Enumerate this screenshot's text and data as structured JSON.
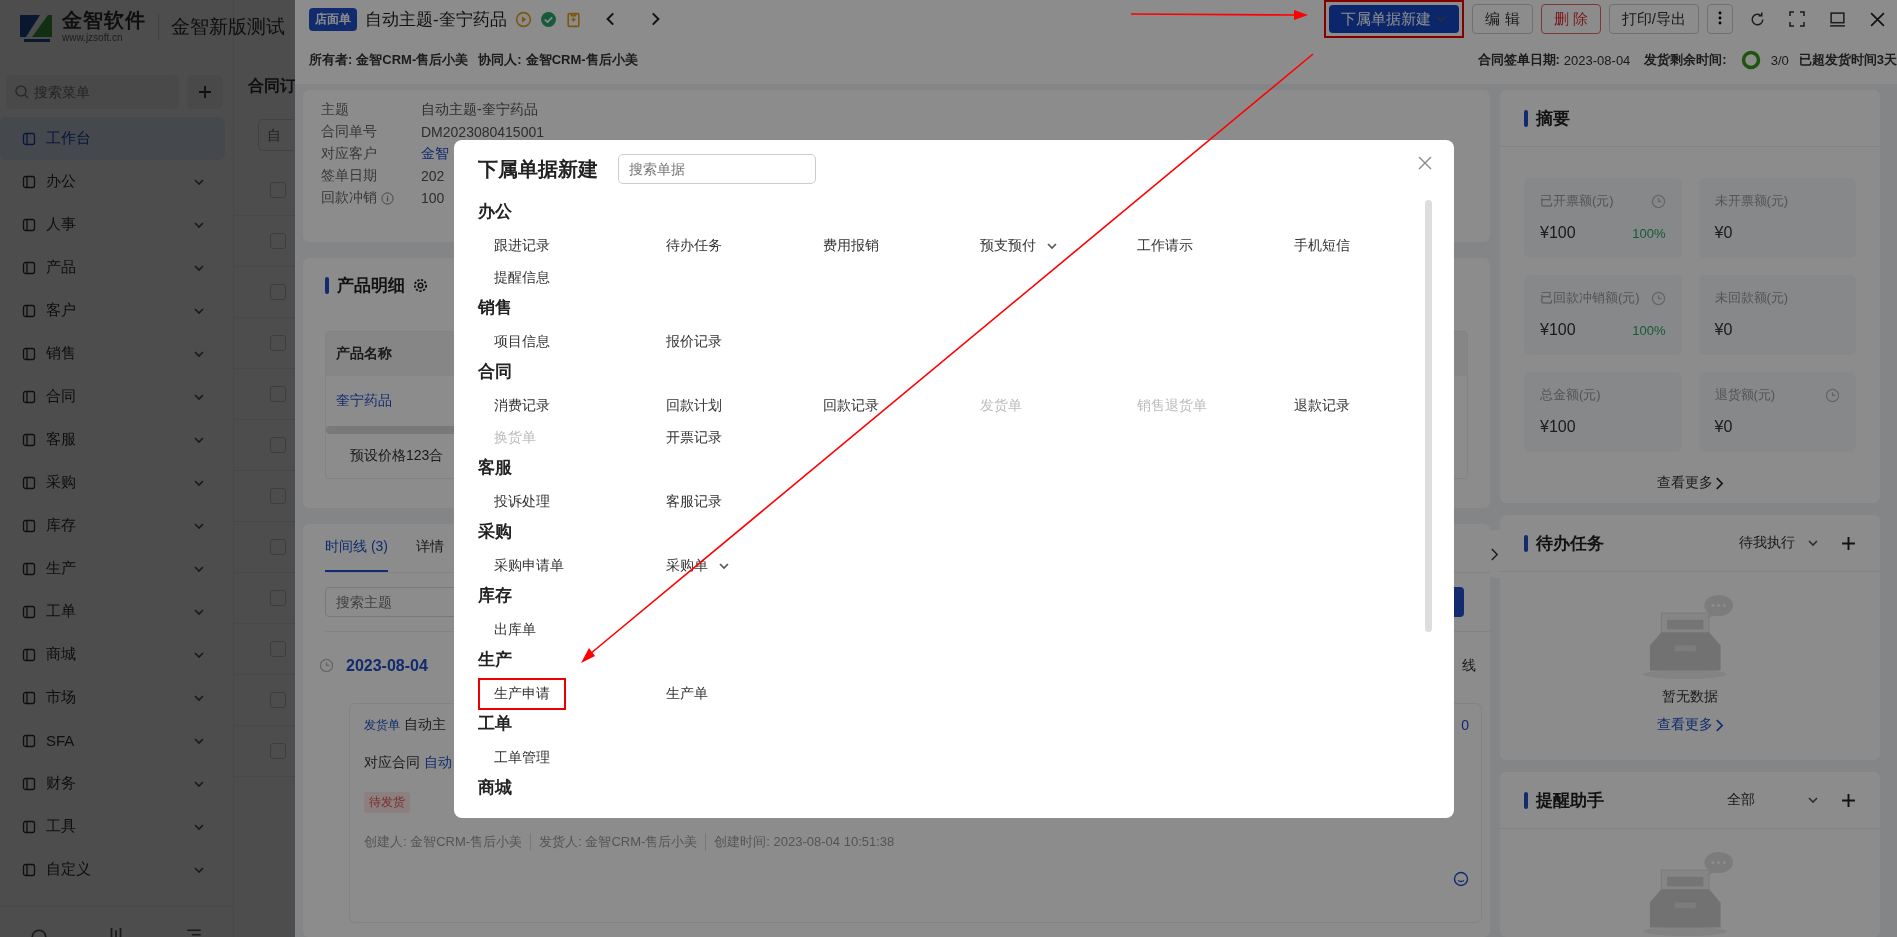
{
  "app": {
    "logo_name": "金智软件",
    "logo_url": "www.jzsoft.cn",
    "company": "金智新版测试",
    "menu_search": {
      "placeholder": "搜索菜单"
    },
    "menu": [
      {
        "label": "工作台",
        "selected": true,
        "kind": "link"
      },
      {
        "label": "办公",
        "selected": false,
        "kind": "group"
      },
      {
        "label": "人事",
        "selected": false,
        "kind": "group"
      },
      {
        "label": "产品",
        "selected": false,
        "kind": "group"
      },
      {
        "label": "客户",
        "selected": false,
        "kind": "group"
      },
      {
        "label": "销售",
        "selected": false,
        "kind": "group"
      },
      {
        "label": "合同",
        "selected": false,
        "kind": "group"
      },
      {
        "label": "客服",
        "selected": false,
        "kind": "group"
      },
      {
        "label": "采购",
        "selected": false,
        "kind": "group"
      },
      {
        "label": "库存",
        "selected": false,
        "kind": "group"
      },
      {
        "label": "生产",
        "selected": false,
        "kind": "group"
      },
      {
        "label": "工单",
        "selected": false,
        "kind": "group"
      },
      {
        "label": "商城",
        "selected": false,
        "kind": "group"
      },
      {
        "label": "市场",
        "selected": false,
        "kind": "group"
      },
      {
        "label": "SFA",
        "selected": false,
        "kind": "group"
      },
      {
        "label": "财务",
        "selected": false,
        "kind": "group"
      },
      {
        "label": "工具",
        "selected": false,
        "kind": "group"
      },
      {
        "label": "自定义",
        "selected": false,
        "kind": "group"
      }
    ],
    "list_title": "合同订",
    "filter": {
      "placeholder": "自"
    },
    "rows": [
      {
        "checked": false
      },
      {
        "checked": false
      },
      {
        "checked": false
      },
      {
        "checked": false
      },
      {
        "checked": false
      },
      {
        "checked": false
      },
      {
        "checked": false
      },
      {
        "checked": false
      },
      {
        "checked": false
      },
      {
        "checked": false
      },
      {
        "checked": false
      },
      {
        "checked": false
      }
    ]
  },
  "drawer": {
    "badge": "店面单",
    "title": "自动主题-奎宁药品",
    "primary_button": {
      "label": "下属单据新建",
      "highlighted": true
    },
    "buttons": [
      {
        "label": "编 辑",
        "kind": "default"
      },
      {
        "label": "删 除",
        "kind": "danger"
      },
      {
        "label": "打印/导出",
        "kind": "default"
      }
    ],
    "owner_label": "所有者:",
    "owner": "金智CRM-售后小美",
    "collab_label": "协同人:",
    "collab": "金智CRM-售后小美",
    "sign_date_label": "合同签单日期:",
    "sign_date": "2023-08-04",
    "ship_label": "发货剩余时间:",
    "ship_count": "3/0",
    "overdue": "已超发货时间3天"
  },
  "details": [
    {
      "label": "主题",
      "value": "自动主题-奎宁药品",
      "kind": "text"
    },
    {
      "label": "合同单号",
      "value": "DM2023080415001",
      "kind": "text"
    },
    {
      "label": "对应客户",
      "value": "金智",
      "kind": "link"
    },
    {
      "label": "签单日期",
      "value": "202",
      "kind": "text"
    },
    {
      "label": "回款冲销",
      "value": "100",
      "kind": "info"
    }
  ],
  "products": {
    "title": "产品明细",
    "columns": [
      "产品名称"
    ],
    "rows": [
      [
        "奎宁药品"
      ]
    ],
    "footer": "预设价格123合"
  },
  "timeline": {
    "tabs": [
      {
        "label": "时间线 (3)",
        "selected": true
      },
      {
        "label": "详情",
        "selected": false
      }
    ],
    "search": {
      "placeholder": "搜索主题"
    },
    "side_text": "线",
    "date": "2023-08-04",
    "entry": {
      "tag": "发货单",
      "subject": "自动主",
      "count": "0",
      "contract_label": "对应合同",
      "contract": "自动",
      "status": "待发货",
      "meta": [
        "创建人: 金智CRM-售后小美",
        "发货人: 金智CRM-售后小美",
        "创建时间: 2023-08-04 10:51:38"
      ]
    }
  },
  "summary": {
    "title": "摘要",
    "tiles": [
      {
        "label": "已开票额(元)",
        "value": "¥100",
        "percent": "100%",
        "history": true
      },
      {
        "label": "未开票额(元)",
        "value": "¥0",
        "history": false
      },
      {
        "label": "已回款冲销额(元)",
        "value": "¥100",
        "percent": "100%",
        "history": true
      },
      {
        "label": "未回款额(元)",
        "value": "¥0",
        "history": false
      },
      {
        "label": "总金额(元)",
        "value": "¥100",
        "history": false
      },
      {
        "label": "退货额(元)",
        "value": "¥0",
        "history": true
      }
    ],
    "more": "查看更多"
  },
  "tasks": {
    "title": "待办任务",
    "filter": "待我执行",
    "empty": "暂无数据",
    "more": "查看更多"
  },
  "reminders": {
    "title": "提醒助手",
    "filter": "全部"
  },
  "modal": {
    "title": "下属单据新建",
    "search": {
      "placeholder": "搜索单据"
    },
    "groups": [
      {
        "name": "办公",
        "items": [
          {
            "label": "跟进记录",
            "disabled": false
          },
          {
            "label": "待办任务",
            "disabled": false
          },
          {
            "label": "费用报销",
            "disabled": false
          },
          {
            "label": "预支预付",
            "disabled": false,
            "has_menu": true
          },
          {
            "label": "工作请示",
            "disabled": false
          },
          {
            "label": "手机短信",
            "disabled": false
          },
          {
            "label": "提醒信息",
            "disabled": false
          }
        ]
      },
      {
        "name": "销售",
        "items": [
          {
            "label": "项目信息",
            "disabled": false
          },
          {
            "label": "报价记录",
            "disabled": false
          }
        ]
      },
      {
        "name": "合同",
        "items": [
          {
            "label": "消费记录",
            "disabled": false
          },
          {
            "label": "回款计划",
            "disabled": false
          },
          {
            "label": "回款记录",
            "disabled": false
          },
          {
            "label": "发货单",
            "disabled": true
          },
          {
            "label": "销售退货单",
            "disabled": true
          },
          {
            "label": "退款记录",
            "disabled": false
          },
          {
            "label": "换货单",
            "disabled": true
          },
          {
            "label": "开票记录",
            "disabled": false
          }
        ]
      },
      {
        "name": "客服",
        "items": [
          {
            "label": "投诉处理",
            "disabled": false
          },
          {
            "label": "客服记录",
            "disabled": false
          }
        ]
      },
      {
        "name": "采购",
        "items": [
          {
            "label": "采购申请单",
            "disabled": false
          },
          {
            "label": "采购单",
            "disabled": false,
            "has_menu": true
          }
        ]
      },
      {
        "name": "库存",
        "items": [
          {
            "label": "出库单",
            "disabled": false
          }
        ]
      },
      {
        "name": "生产",
        "items": [
          {
            "label": "生产申请",
            "disabled": false,
            "highlighted": true
          },
          {
            "label": "生产单",
            "disabled": false
          }
        ]
      },
      {
        "name": "工单",
        "items": [
          {
            "label": "工单管理",
            "disabled": false
          }
        ]
      },
      {
        "name": "商城"
      }
    ]
  }
}
